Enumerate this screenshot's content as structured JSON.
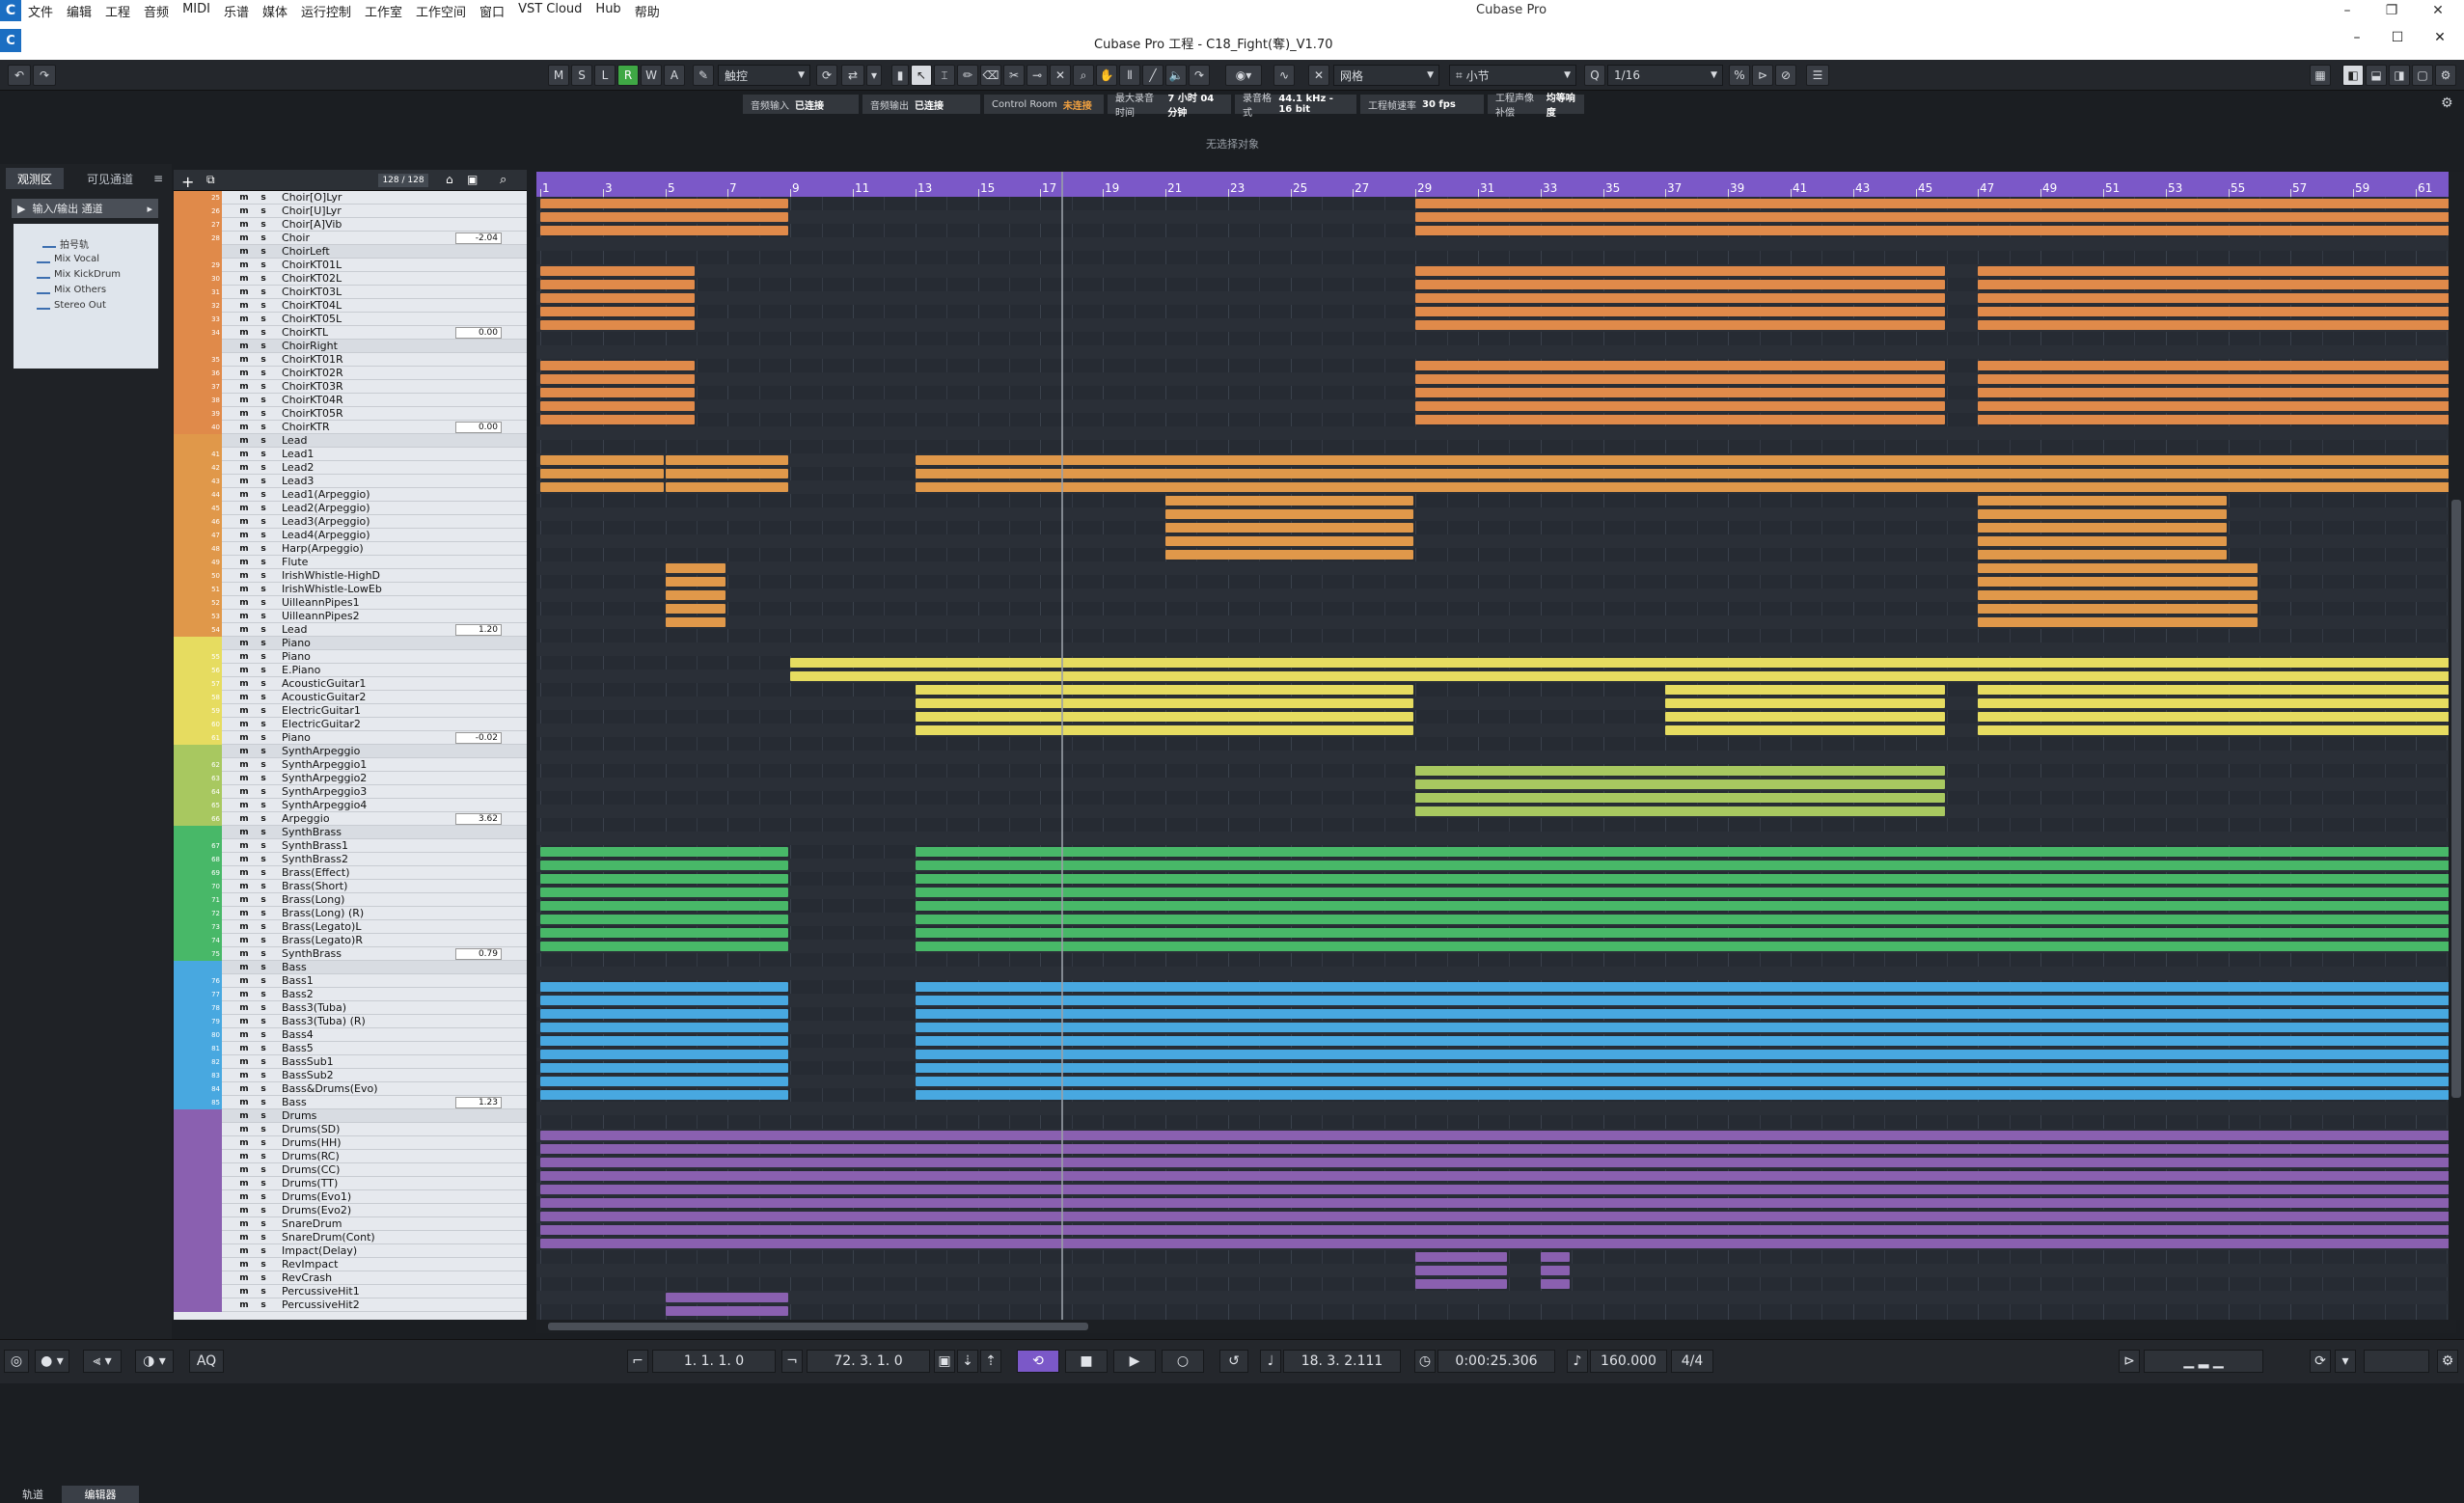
{
  "menubar": {
    "items": [
      "文件",
      "编辑",
      "工程",
      "音频",
      "MIDI",
      "乐谱",
      "媒体",
      "运行控制",
      "工作室",
      "工作空间",
      "窗口",
      "VST Cloud",
      "Hub",
      "帮助"
    ],
    "app_title": "Cubase Pro",
    "minimize": "–",
    "restore": "❐",
    "close": "✕"
  },
  "project": {
    "title": "Cubase Pro 工程 - C18_Fight(奪)_V1.70",
    "minimize": "–",
    "maximize": "☐",
    "close": "✕"
  },
  "toolbar": {
    "undo": "↶",
    "redo": "↷",
    "m": "M",
    "s": "S",
    "l": "L",
    "r": "R",
    "w": "W",
    "a": "A",
    "automation_mode": "触控",
    "grid_type": "网格",
    "grid_unit": "小节",
    "quantize": "1/16"
  },
  "infobar": [
    {
      "label": "音频输入",
      "value": "已连接",
      "warn": false
    },
    {
      "label": "音频输出",
      "value": "已连接",
      "warn": false
    },
    {
      "label": "Control Room",
      "value": "未连接",
      "warn": true
    },
    {
      "label": "最大录音时间",
      "value": "7 小时 04 分钟",
      "warn": false
    },
    {
      "label": "录音格式",
      "value": "44.1 kHz - 16 bit",
      "warn": false
    },
    {
      "label": "工程帧速率",
      "value": "30 fps",
      "warn": false
    },
    {
      "label": "工程声像补偿",
      "value": "均等响度",
      "warn": false
    }
  ],
  "no_object": "无选择对象",
  "left_zone": {
    "tab_inspector": "观测区",
    "tab_visibility": "可见通道",
    "section": "输入/输出 通道",
    "routing": [
      "拍号轨",
      "Mix Vocal",
      "Mix KickDrum",
      "Mix Others",
      "Stereo Out"
    ],
    "bottom_tab_tracks": "轨道",
    "bottom_tab_editor": "编辑器"
  },
  "track_header": {
    "count": "128 / 128"
  },
  "tracks": [
    {
      "n": "25",
      "name": "Choir[O]Lyr",
      "c": "#e08a4a",
      "type": "a",
      "vol": ""
    },
    {
      "n": "26",
      "name": "Choir[U]Lyr",
      "c": "#e08a4a",
      "type": "a",
      "vol": ""
    },
    {
      "n": "27",
      "name": "Choir[A]Vib",
      "c": "#e08a4a",
      "type": "a",
      "vol": ""
    },
    {
      "n": "28",
      "name": "Choir",
      "c": "#e08a4a",
      "type": "g",
      "vol": "-2.04"
    },
    {
      "n": "",
      "name": "ChoirLeft",
      "c": "#e08a4a",
      "type": "f",
      "vol": ""
    },
    {
      "n": "29",
      "name": "ChoirKT01L",
      "c": "#e08a4a",
      "type": "a",
      "vol": ""
    },
    {
      "n": "30",
      "name": "ChoirKT02L",
      "c": "#e08a4a",
      "type": "a",
      "vol": ""
    },
    {
      "n": "31",
      "name": "ChoirKT03L",
      "c": "#e08a4a",
      "type": "a",
      "vol": ""
    },
    {
      "n": "32",
      "name": "ChoirKT04L",
      "c": "#e08a4a",
      "type": "a",
      "vol": ""
    },
    {
      "n": "33",
      "name": "ChoirKT05L",
      "c": "#e08a4a",
      "type": "a",
      "vol": ""
    },
    {
      "n": "34",
      "name": "ChoirKTL",
      "c": "#e08a4a",
      "type": "g",
      "vol": "0.00"
    },
    {
      "n": "",
      "name": "ChoirRight",
      "c": "#e08a4a",
      "type": "f",
      "vol": ""
    },
    {
      "n": "35",
      "name": "ChoirKT01R",
      "c": "#e08a4a",
      "type": "a",
      "vol": ""
    },
    {
      "n": "36",
      "name": "ChoirKT02R",
      "c": "#e08a4a",
      "type": "a",
      "vol": ""
    },
    {
      "n": "37",
      "name": "ChoirKT03R",
      "c": "#e08a4a",
      "type": "a",
      "vol": ""
    },
    {
      "n": "38",
      "name": "ChoirKT04R",
      "c": "#e08a4a",
      "type": "a",
      "vol": ""
    },
    {
      "n": "39",
      "name": "ChoirKT05R",
      "c": "#e08a4a",
      "type": "a",
      "vol": ""
    },
    {
      "n": "40",
      "name": "ChoirKTR",
      "c": "#e08a4a",
      "type": "g",
      "vol": "0.00"
    },
    {
      "n": "",
      "name": "Lead",
      "c": "#e0984a",
      "type": "f",
      "vol": ""
    },
    {
      "n": "41",
      "name": "Lead1",
      "c": "#e0984a",
      "type": "a",
      "vol": ""
    },
    {
      "n": "42",
      "name": "Lead2",
      "c": "#e0984a",
      "type": "a",
      "vol": ""
    },
    {
      "n": "43",
      "name": "Lead3",
      "c": "#e0984a",
      "type": "a",
      "vol": ""
    },
    {
      "n": "44",
      "name": "Lead1(Arpeggio)",
      "c": "#e0984a",
      "type": "a",
      "vol": ""
    },
    {
      "n": "45",
      "name": "Lead2(Arpeggio)",
      "c": "#e0984a",
      "type": "a",
      "vol": ""
    },
    {
      "n": "46",
      "name": "Lead3(Arpeggio)",
      "c": "#e0984a",
      "type": "a",
      "vol": ""
    },
    {
      "n": "47",
      "name": "Lead4(Arpeggio)",
      "c": "#e0984a",
      "type": "a",
      "vol": ""
    },
    {
      "n": "48",
      "name": "Harp(Arpeggio)",
      "c": "#e0984a",
      "type": "a",
      "vol": ""
    },
    {
      "n": "49",
      "name": "Flute",
      "c": "#e0984a",
      "type": "a",
      "vol": ""
    },
    {
      "n": "50",
      "name": "IrishWhistle-HighD",
      "c": "#e0984a",
      "type": "a",
      "vol": ""
    },
    {
      "n": "51",
      "name": "IrishWhistle-LowEb",
      "c": "#e0984a",
      "type": "a",
      "vol": ""
    },
    {
      "n": "52",
      "name": "UilleannPipes1",
      "c": "#e0984a",
      "type": "a",
      "vol": ""
    },
    {
      "n": "53",
      "name": "UilleannPipes2",
      "c": "#e0984a",
      "type": "a",
      "vol": ""
    },
    {
      "n": "54",
      "name": "Lead",
      "c": "#e0984a",
      "type": "g",
      "vol": "1.20"
    },
    {
      "n": "",
      "name": "Piano",
      "c": "#e6dc60",
      "type": "f",
      "vol": ""
    },
    {
      "n": "55",
      "name": "Piano",
      "c": "#e6dc60",
      "type": "a",
      "vol": ""
    },
    {
      "n": "56",
      "name": "E.Piano",
      "c": "#e6dc60",
      "type": "a",
      "vol": ""
    },
    {
      "n": "57",
      "name": "AcousticGuitar1",
      "c": "#e6dc60",
      "type": "a",
      "vol": ""
    },
    {
      "n": "58",
      "name": "AcousticGuitar2",
      "c": "#e6dc60",
      "type": "a",
      "vol": ""
    },
    {
      "n": "59",
      "name": "ElectricGuitar1",
      "c": "#e6dc60",
      "type": "a",
      "vol": ""
    },
    {
      "n": "60",
      "name": "ElectricGuitar2",
      "c": "#e6dc60",
      "type": "a",
      "vol": ""
    },
    {
      "n": "61",
      "name": "Piano",
      "c": "#e6dc60",
      "type": "g",
      "vol": "-0.02"
    },
    {
      "n": "",
      "name": "SynthArpeggio",
      "c": "#a8c860",
      "type": "f",
      "vol": ""
    },
    {
      "n": "62",
      "name": "SynthArpeggio1",
      "c": "#a8c860",
      "type": "a",
      "vol": ""
    },
    {
      "n": "63",
      "name": "SynthArpeggio2",
      "c": "#a8c860",
      "type": "a",
      "vol": ""
    },
    {
      "n": "64",
      "name": "SynthArpeggio3",
      "c": "#a8c860",
      "type": "a",
      "vol": ""
    },
    {
      "n": "65",
      "name": "SynthArpeggio4",
      "c": "#a8c860",
      "type": "a",
      "vol": ""
    },
    {
      "n": "66",
      "name": "Arpeggio",
      "c": "#a8c860",
      "type": "g",
      "vol": "3.62"
    },
    {
      "n": "",
      "name": "SynthBrass",
      "c": "#48b868",
      "type": "f",
      "vol": ""
    },
    {
      "n": "67",
      "name": "SynthBrass1",
      "c": "#48b868",
      "type": "a",
      "vol": ""
    },
    {
      "n": "68",
      "name": "SynthBrass2",
      "c": "#48b868",
      "type": "a",
      "vol": ""
    },
    {
      "n": "69",
      "name": "Brass(Effect)",
      "c": "#48b868",
      "type": "a",
      "vol": ""
    },
    {
      "n": "70",
      "name": "Brass(Short)",
      "c": "#48b868",
      "type": "a",
      "vol": ""
    },
    {
      "n": "71",
      "name": "Brass(Long)",
      "c": "#48b868",
      "type": "a",
      "vol": ""
    },
    {
      "n": "72",
      "name": "Brass(Long) (R)",
      "c": "#48b868",
      "type": "a",
      "vol": ""
    },
    {
      "n": "73",
      "name": "Brass(Legato)L",
      "c": "#48b868",
      "type": "a",
      "vol": ""
    },
    {
      "n": "74",
      "name": "Brass(Legato)R",
      "c": "#48b868",
      "type": "a",
      "vol": ""
    },
    {
      "n": "75",
      "name": "SynthBrass",
      "c": "#48b868",
      "type": "g",
      "vol": "0.79"
    },
    {
      "n": "",
      "name": "Bass",
      "c": "#48a8e0",
      "type": "f",
      "vol": ""
    },
    {
      "n": "76",
      "name": "Bass1",
      "c": "#48a8e0",
      "type": "a",
      "vol": ""
    },
    {
      "n": "77",
      "name": "Bass2",
      "c": "#48a8e0",
      "type": "a",
      "vol": ""
    },
    {
      "n": "78",
      "name": "Bass3(Tuba)",
      "c": "#48a8e0",
      "type": "a",
      "vol": ""
    },
    {
      "n": "79",
      "name": "Bass3(Tuba) (R)",
      "c": "#48a8e0",
      "type": "a",
      "vol": ""
    },
    {
      "n": "80",
      "name": "Bass4",
      "c": "#48a8e0",
      "type": "a",
      "vol": ""
    },
    {
      "n": "81",
      "name": "Bass5",
      "c": "#48a8e0",
      "type": "a",
      "vol": ""
    },
    {
      "n": "82",
      "name": "BassSub1",
      "c": "#48a8e0",
      "type": "a",
      "vol": ""
    },
    {
      "n": "83",
      "name": "BassSub2",
      "c": "#48a8e0",
      "type": "a",
      "vol": ""
    },
    {
      "n": "84",
      "name": "Bass&Drums(Evo)",
      "c": "#48a8e0",
      "type": "a",
      "vol": ""
    },
    {
      "n": "85",
      "name": "Bass",
      "c": "#48a8e0",
      "type": "g",
      "vol": "1.23"
    },
    {
      "n": "",
      "name": "Drums",
      "c": "#8a60b0",
      "type": "f",
      "vol": ""
    },
    {
      "n": "",
      "name": "Drums(SD)",
      "c": "#8a60b0",
      "type": "d",
      "vol": ""
    },
    {
      "n": "",
      "name": "Drums(HH)",
      "c": "#8a60b0",
      "type": "d",
      "vol": ""
    },
    {
      "n": "",
      "name": "Drums(RC)",
      "c": "#8a60b0",
      "type": "d",
      "vol": ""
    },
    {
      "n": "",
      "name": "Drums(CC)",
      "c": "#8a60b0",
      "type": "d",
      "vol": ""
    },
    {
      "n": "",
      "name": "Drums(TT)",
      "c": "#8a60b0",
      "type": "d",
      "vol": ""
    },
    {
      "n": "",
      "name": "Drums(Evo1)",
      "c": "#8a60b0",
      "type": "d",
      "vol": ""
    },
    {
      "n": "",
      "name": "Drums(Evo2)",
      "c": "#8a60b0",
      "type": "d",
      "vol": ""
    },
    {
      "n": "",
      "name": "SnareDrum",
      "c": "#8a60b0",
      "type": "d",
      "vol": ""
    },
    {
      "n": "",
      "name": "SnareDrum(Cont)",
      "c": "#8a60b0",
      "type": "d",
      "vol": ""
    },
    {
      "n": "",
      "name": "Impact(Delay)",
      "c": "#8a60b0",
      "type": "d",
      "vol": ""
    },
    {
      "n": "",
      "name": "RevImpact",
      "c": "#8a60b0",
      "type": "d",
      "vol": ""
    },
    {
      "n": "",
      "name": "RevCrash",
      "c": "#8a60b0",
      "type": "d",
      "vol": ""
    },
    {
      "n": "",
      "name": "PercussiveHit1",
      "c": "#8a60b0",
      "type": "d",
      "vol": ""
    },
    {
      "n": "",
      "name": "PercussiveHit2",
      "c": "#8a60b0",
      "type": "d",
      "vol": ""
    }
  ],
  "ruler_bars": [
    "1",
    "3",
    "5",
    "7",
    "9",
    "11",
    "13",
    "15",
    "17",
    "19",
    "21",
    "23",
    "25",
    "27",
    "29",
    "31",
    "33",
    "35",
    "37",
    "39",
    "41",
    "43",
    "45",
    "47",
    "49",
    "51",
    "53",
    "55",
    "57",
    "59",
    "61"
  ],
  "transport": {
    "left_locator": "1. 1. 1. 0",
    "right_locator": "72. 3. 1. 0",
    "position_bars": "18. 3. 2.111",
    "position_time": "0:00:25.306",
    "tempo": "160.000",
    "signature": "4/4",
    "aq": "AQ"
  }
}
